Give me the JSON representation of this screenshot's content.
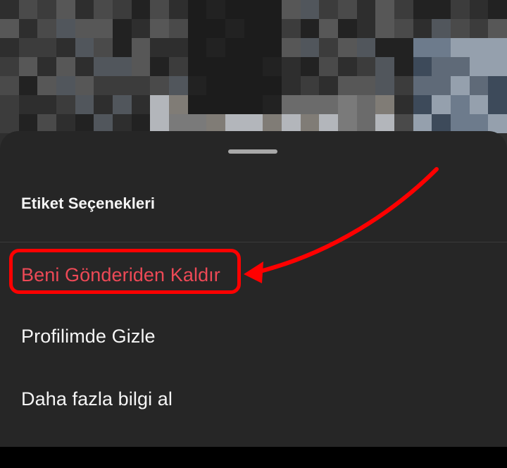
{
  "background_photo": {
    "palette": [
      "#3c3c3c",
      "#575757",
      "#2e2e2e",
      "#6b6b6b",
      "#4a4a4a",
      "#222222",
      "#7a7a7a",
      "#5f6a78",
      "#3d4a5a",
      "#807c76",
      "#1c1c1c",
      "#95a0ad",
      "#6d7b8c",
      "#51565c",
      "#b3b6bb"
    ]
  },
  "sheet": {
    "title": "Etiket Seçenekleri",
    "options": [
      {
        "label": "Beni Gönderiden Kaldır",
        "style": "destructive",
        "color": "#ed4956"
      },
      {
        "label": "Profilimde Gizle"
      },
      {
        "label": "Daha fazla bilgi al"
      }
    ]
  },
  "annotation": {
    "type": "highlight-with-arrow",
    "color": "#ff0000",
    "target": "Beni Gönderiden Kaldır"
  }
}
